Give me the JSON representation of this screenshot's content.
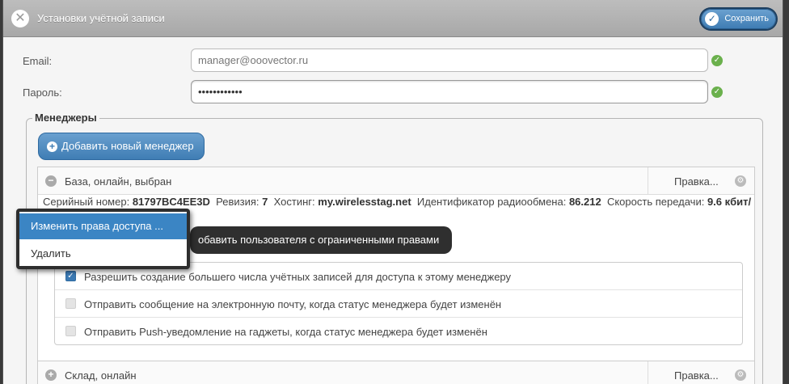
{
  "titlebar": {
    "title": "Установки учётной записи",
    "save_label": "Сохранить"
  },
  "form": {
    "email_label": "Email:",
    "email_value": "manager@ooovector.ru",
    "password_label": "Пароль:",
    "password_value": "••••••••••••"
  },
  "managers": {
    "legend": "Менеджеры",
    "add_button": "Добавить новый менеджер",
    "items": [
      {
        "name": "База, онлайн, выбран",
        "edit_label": "Правка...",
        "info": {
          "serial_label": "Серийный номер:",
          "serial_value": "81797BC4EE3D",
          "revision_label": "Ревизия:",
          "revision_value": "7",
          "hosting_label": "Хостинг:",
          "hosting_value": "my.wirelesstag.net",
          "radio_label": "Идентификатор радиообмена:",
          "radio_value": "86.212",
          "speed_label": "Скорость передачи:",
          "speed_value": "9.6 кбит/"
        },
        "add_limited_user": "обавить пользователя с ограниченными правами",
        "permissions": [
          {
            "label": "Разрешить создание большего числа учётных записей для доступа к этому менеджеру",
            "checked": true
          },
          {
            "label": "Отправить сообщение на электронную почту, когда статус менеджера будет изменён",
            "checked": false
          },
          {
            "label": "Отправить Push-уведомление на гаджеты, когда статус менеджера будет изменён",
            "checked": false
          }
        ]
      },
      {
        "name": "Склад, онлайн",
        "edit_label": "Правка..."
      }
    ]
  },
  "context_menu": {
    "items": [
      "Изменить права доступа ...",
      "Удалить"
    ]
  },
  "colors": {
    "accent": "#3f7db4",
    "ok": "#6ab04c"
  }
}
